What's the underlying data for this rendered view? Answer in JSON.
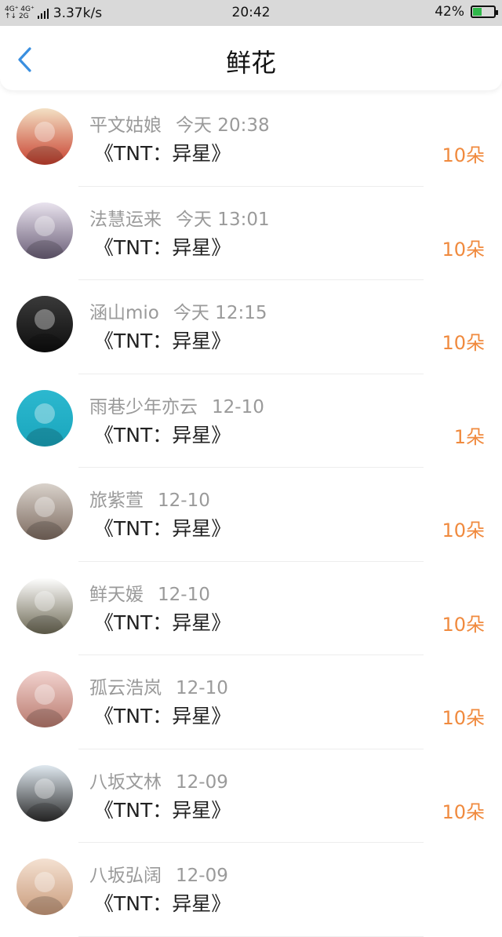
{
  "status_bar": {
    "network_top": "4G⁺ 4G⁺",
    "network_bottom": "↑↓ 2G",
    "speed": "3.37k/s",
    "time": "20:42",
    "battery_percent": "42%",
    "battery_level": 0.42,
    "battery_color": "#2fb84a"
  },
  "header": {
    "title": "鲜花"
  },
  "accent_color": "#f08a3e",
  "back_color": "#3a8fe0",
  "items": [
    {
      "name": "平文姑娘",
      "time": "今天 20:38",
      "book": "《TNT：异星》",
      "count": "10朵",
      "avatar": {
        "c1": "#f3e0c4",
        "c2": "#c8412f"
      }
    },
    {
      "name": "法慧运来",
      "time": "今天 13:01",
      "book": "《TNT：异星》",
      "count": "10朵",
      "avatar": {
        "c1": "#e9e3ee",
        "c2": "#6b5f78"
      }
    },
    {
      "name": "涵山mio",
      "time": "今天 12:15",
      "book": "《TNT：异星》",
      "count": "10朵",
      "avatar": {
        "c1": "#3a3a3a",
        "c2": "#0e0e0e"
      }
    },
    {
      "name": "雨巷少年亦云",
      "time": "12-10",
      "book": "《TNT：异星》",
      "count": "1朵",
      "avatar": {
        "c1": "#2cb8cf",
        "c2": "#1aa6bd"
      }
    },
    {
      "name": "旅紫萱",
      "time": "12-10",
      "book": "《TNT：异星》",
      "count": "10朵",
      "avatar": {
        "c1": "#d9d2cb",
        "c2": "#7d6b60"
      }
    },
    {
      "name": "鲜天媛",
      "time": "12-10",
      "book": "《TNT：异星》",
      "count": "10朵",
      "avatar": {
        "c1": "#ffffff",
        "c2": "#6e6a55"
      }
    },
    {
      "name": "孤云浩岚",
      "time": "12-10",
      "book": "《TNT：异星》",
      "count": "10朵",
      "avatar": {
        "c1": "#f2d3cf",
        "c2": "#b97a6e"
      }
    },
    {
      "name": "八坂文林",
      "time": "12-09",
      "book": "《TNT：异星》",
      "count": "10朵",
      "avatar": {
        "c1": "#dfe8ef",
        "c2": "#2c2c2c"
      }
    },
    {
      "name": "八坂弘阔",
      "time": "12-09",
      "book": "《TNT：异星》",
      "count": "",
      "avatar": {
        "c1": "#f4e1d2",
        "c2": "#c99b7b"
      }
    }
  ]
}
